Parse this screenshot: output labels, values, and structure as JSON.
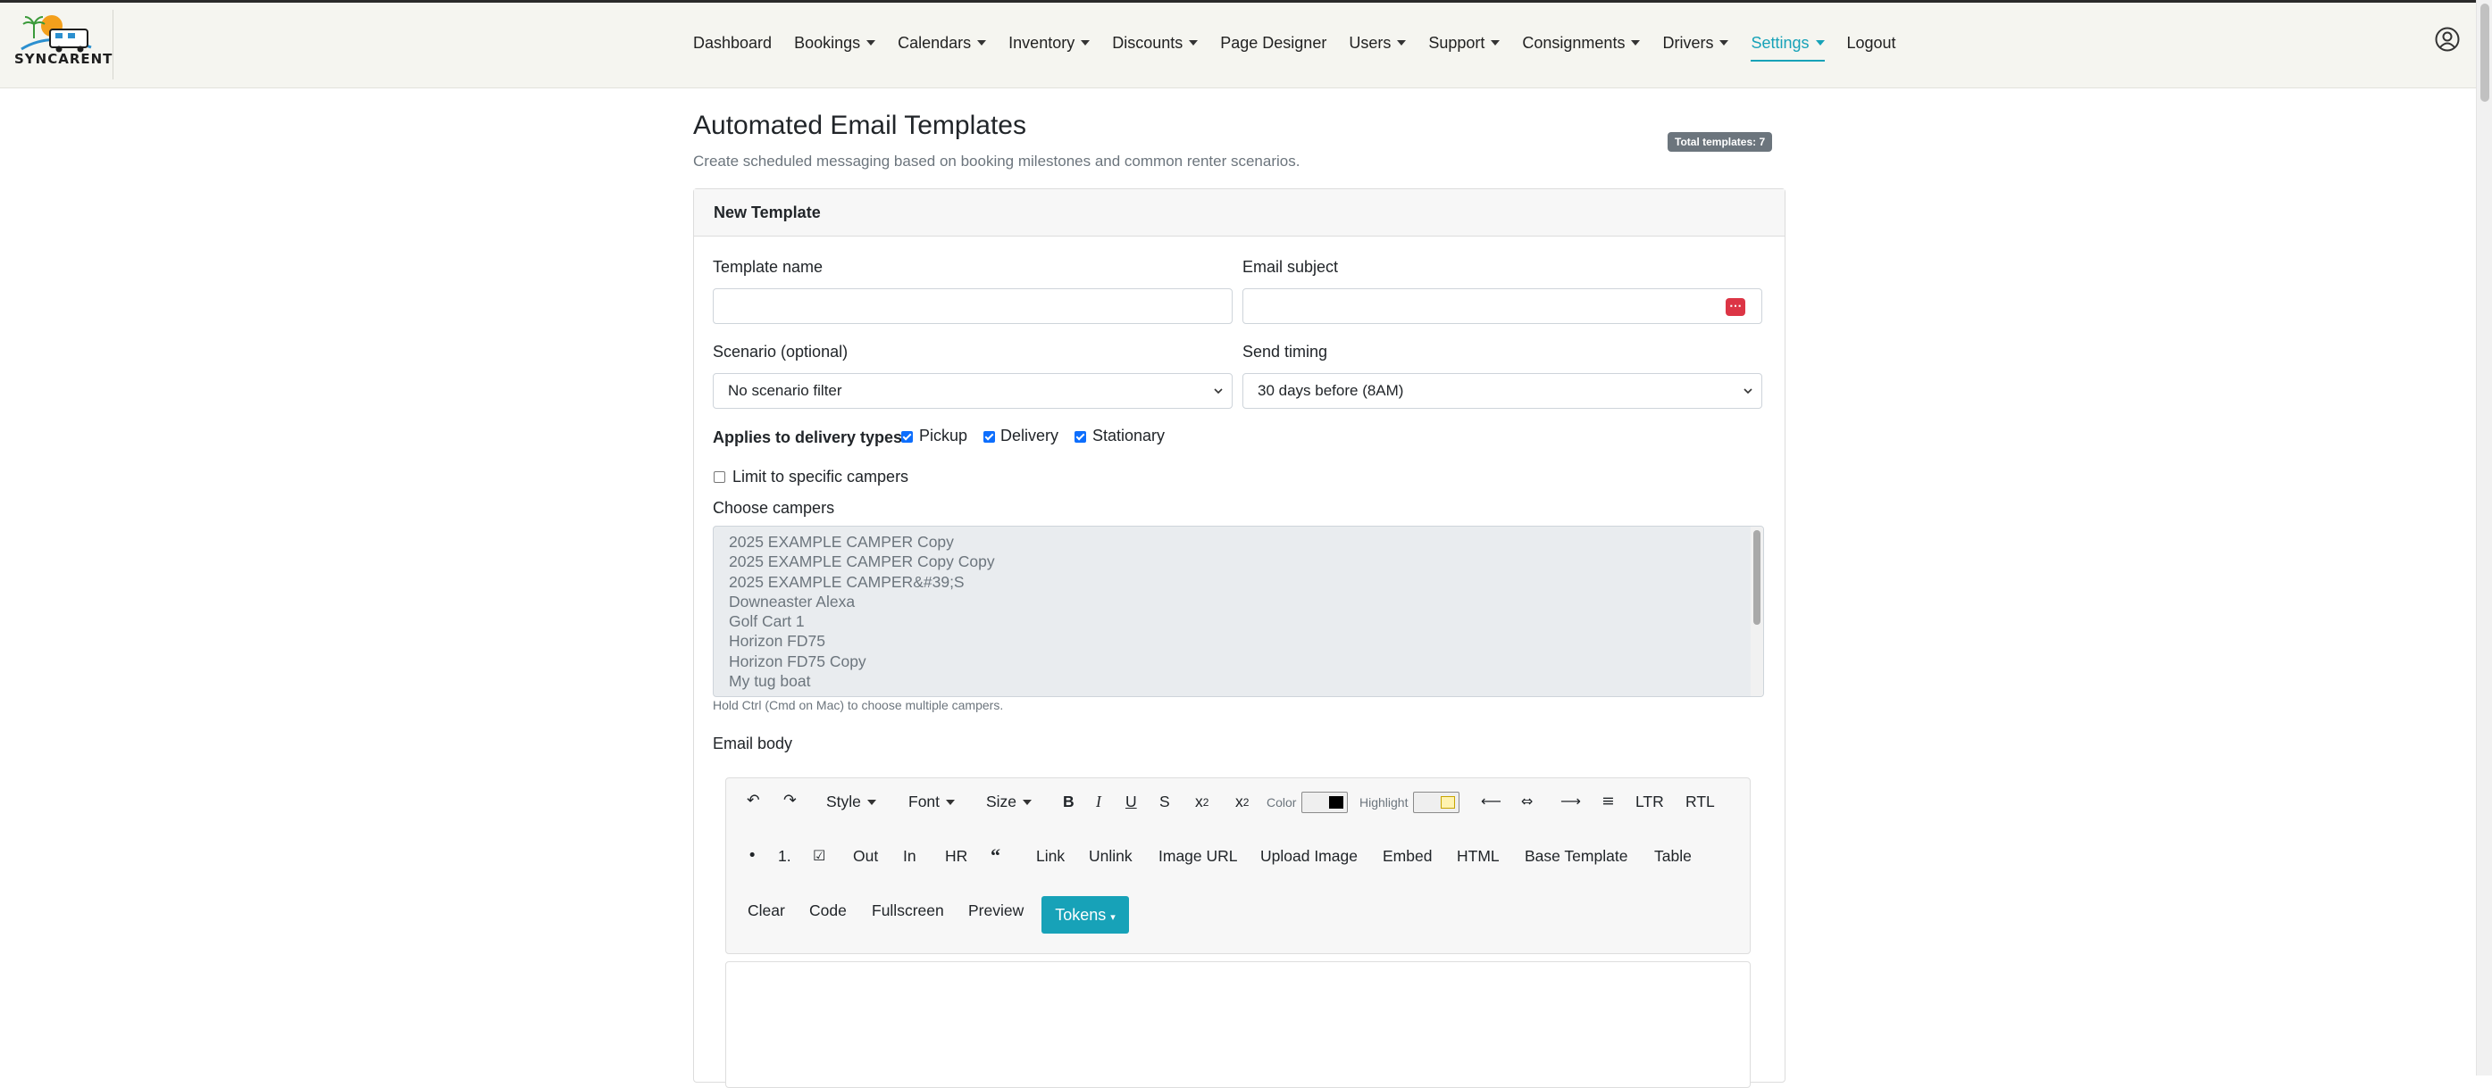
{
  "brand": {
    "logo_text": "SYNCARENT"
  },
  "nav": {
    "items": [
      {
        "label": "Dashboard",
        "dropdown": false
      },
      {
        "label": "Bookings",
        "dropdown": true
      },
      {
        "label": "Calendars",
        "dropdown": true
      },
      {
        "label": "Inventory",
        "dropdown": true
      },
      {
        "label": "Discounts",
        "dropdown": true
      },
      {
        "label": "Page Designer",
        "dropdown": false
      },
      {
        "label": "Users",
        "dropdown": true
      },
      {
        "label": "Support",
        "dropdown": true
      },
      {
        "label": "Consignments",
        "dropdown": true
      },
      {
        "label": "Drivers",
        "dropdown": true
      },
      {
        "label": "Settings",
        "dropdown": true,
        "active": true
      },
      {
        "label": "Logout",
        "dropdown": false
      }
    ],
    "user_icon": "user-circle-icon"
  },
  "page": {
    "title": "Automated Email Templates",
    "subtitle": "Create scheduled messaging based on booking milestones and common renter scenarios.",
    "total_badge": "Total templates: 7"
  },
  "form": {
    "card_title": "New Template",
    "template_name_label": "Template name",
    "template_name_value": "",
    "email_subject_label": "Email subject",
    "email_subject_value": "",
    "scenario_label": "Scenario (optional)",
    "scenario_value": "No scenario filter",
    "send_timing_label": "Send timing",
    "send_timing_value": "30 days before (8AM)",
    "delivery_types_label": "Applies to delivery types",
    "delivery_types": [
      {
        "label": "Pickup",
        "checked": true
      },
      {
        "label": "Delivery",
        "checked": true
      },
      {
        "label": "Stationary",
        "checked": true
      }
    ],
    "limit_campers_label": "Limit to specific campers",
    "limit_campers_checked": false,
    "choose_campers_label": "Choose campers",
    "campers": [
      "2025 EXAMPLE CAMPER Copy",
      "2025 EXAMPLE CAMPER Copy Copy",
      "2025 EXAMPLE CAMPER&#39;S",
      "Downeaster Alexa",
      "Golf Cart 1",
      "Horizon FD75",
      "Horizon FD75 Copy",
      "My tug boat"
    ],
    "campers_help": "Hold Ctrl (Cmd on Mac) to choose multiple campers.",
    "email_body_label": "Email body"
  },
  "toolbar": {
    "style": "Style",
    "font": "Font",
    "size": "Size",
    "bold": "B",
    "italic": "I",
    "underline": "U",
    "strike": "S",
    "superscript_base": "x",
    "superscript_exp": "2",
    "subscript_base": "x",
    "subscript_exp": "2",
    "color_label": "Color",
    "color_value": "#000000",
    "highlight_label": "Highlight",
    "highlight_value": "#fff3b0",
    "ltr": "LTR",
    "rtl": "RTL",
    "ordered_list": "1.",
    "outdent": "Out",
    "indent": "In",
    "hr": "HR",
    "link": "Link",
    "unlink": "Unlink",
    "image_url": "Image URL",
    "upload_image": "Upload Image",
    "embed": "Embed",
    "html": "HTML",
    "base_template": "Base Template",
    "table": "Table",
    "clear": "Clear",
    "code": "Code",
    "fullscreen": "Fullscreen",
    "preview": "Preview",
    "tokens": "Tokens"
  },
  "colors": {
    "accent": "#17a2b8",
    "checkbox": "#0d6efd",
    "badge": "#6c757d",
    "danger": "#dc3545"
  }
}
